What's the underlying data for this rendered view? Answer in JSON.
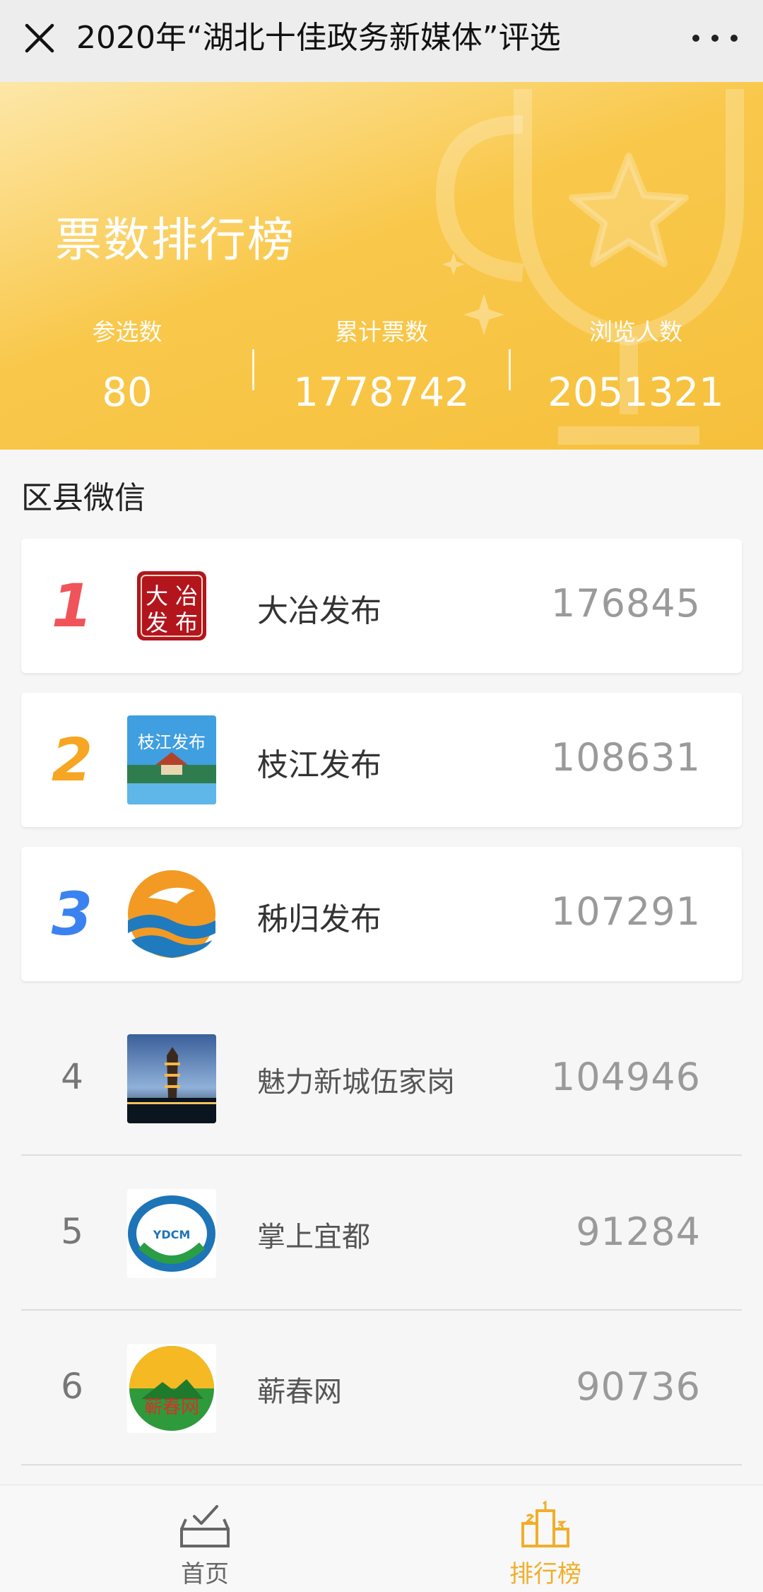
{
  "nav": {
    "title": "2020年“湖北十佳政务新媒体”评选"
  },
  "hero": {
    "heading": "票数排行榜",
    "stats": [
      {
        "label": "参选数",
        "value": "80"
      },
      {
        "label": "累计票数",
        "value": "1778742"
      },
      {
        "label": "浏览人数",
        "value": "2051321"
      }
    ]
  },
  "section": {
    "title": "区县微信"
  },
  "entries": [
    {
      "rank": "1",
      "name": "大冶发布",
      "votes": "176845",
      "logo_text": [
        "大",
        "冶",
        "发",
        "布"
      ]
    },
    {
      "rank": "2",
      "name": "枝江发布",
      "votes": "108631",
      "logo_text": "枝江发布"
    },
    {
      "rank": "3",
      "name": "秭归发布",
      "votes": "107291"
    },
    {
      "rank": "4",
      "name": "魅力新城伍家岗",
      "votes": "104946"
    },
    {
      "rank": "5",
      "name": "掌上宜都",
      "votes": "91284",
      "logo_text": "YDCM"
    },
    {
      "rank": "6",
      "name": "蕲春网",
      "votes": "90736",
      "logo_text": "蕲春网"
    }
  ],
  "rank_colors": {
    "1": "#f0535a",
    "2": "#f6a623",
    "3": "#3b82f0"
  },
  "tabbar": {
    "home_label": "首页",
    "rank_label": "排行榜",
    "active_color": "#f1ae2a"
  }
}
